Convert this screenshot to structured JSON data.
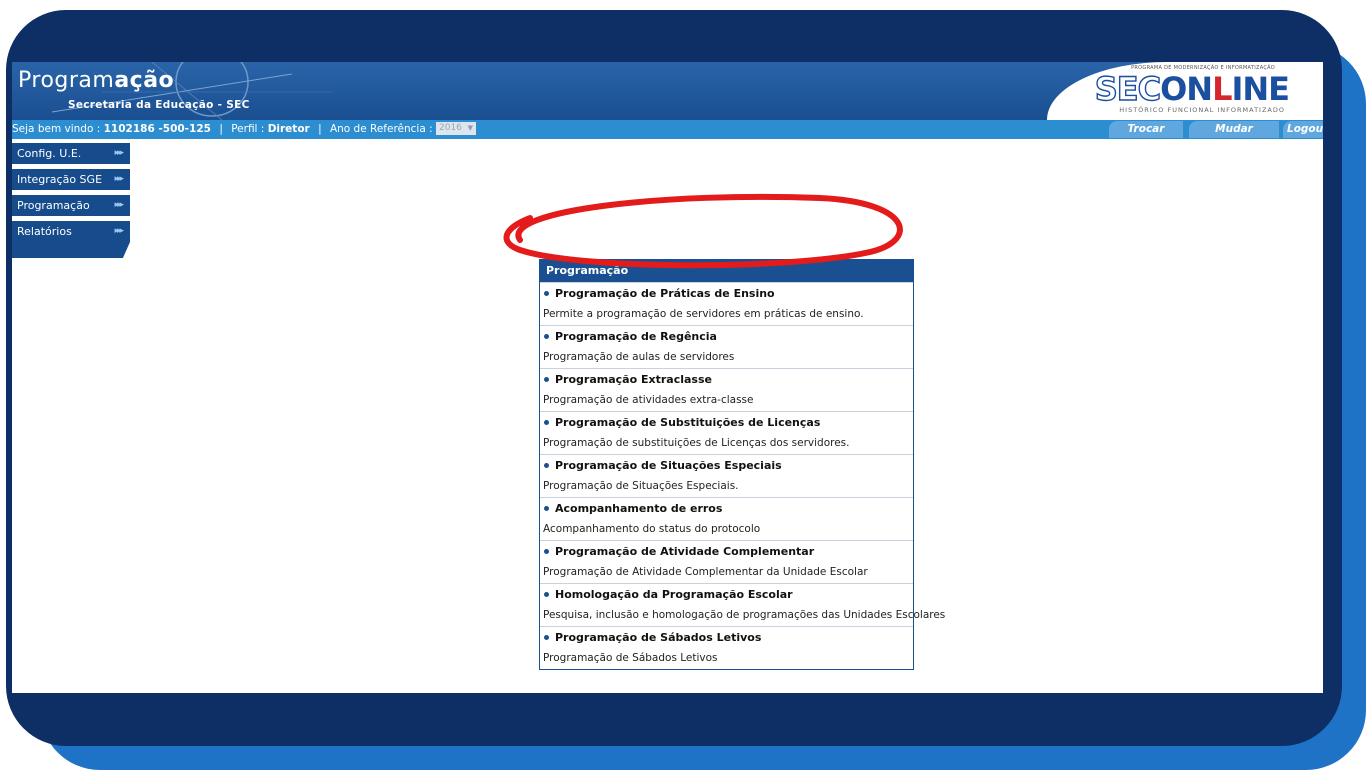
{
  "header": {
    "title_part1": "Program",
    "title_part2": "ação",
    "subtitle": "Secretaria da Educação - SEC",
    "logo": {
      "tagline": "PROGRAMA DE MODERNIZAÇÃO E INFORMATIZAÇÃO",
      "sec": "SEC",
      "online_on": "ON",
      "online_l": "L",
      "online_ine": "INE",
      "sub": "HISTÓRICO FUNCIONAL INFORMATIZADO"
    }
  },
  "topbar": {
    "welcome_label": "Seja bem vindo :",
    "welcome_value": "1102186 -500-125",
    "profile_label": "Perfil :",
    "profile_value": "Diretor",
    "year_label": "Ano de Referência :",
    "year_value": "2016",
    "actions": [
      "Trocar Senha",
      "Mudar Sistema",
      "Logout"
    ]
  },
  "sidebar": {
    "items": [
      {
        "label": "Config. U.E."
      },
      {
        "label": "Integração SGE"
      },
      {
        "label": "Programação"
      },
      {
        "label": "Relatórios"
      }
    ],
    "arrow_glyph": "▸▸▸"
  },
  "panel": {
    "title": "Programação",
    "entries": [
      {
        "title": "Programação de Práticas de Ensino",
        "desc": "Permite a programação de servidores em práticas de ensino."
      },
      {
        "title": "Programação de Regência",
        "desc": "Programação de aulas de servidores"
      },
      {
        "title": "Programação Extraclasse",
        "desc": "Programação de atividades extra-classe"
      },
      {
        "title": "Programação de Substituições de Licenças",
        "desc": "Programação de substituições de Licenças dos servidores."
      },
      {
        "title": "Programação de Situações Especiais",
        "desc": "Programação de Situações Especiais."
      },
      {
        "title": "Acompanhamento de erros",
        "desc": "Acompanhamento do status do protocolo"
      },
      {
        "title": "Programação de Atividade Complementar",
        "desc": "Programação de Atividade Complementar da Unidade Escolar"
      },
      {
        "title": "Homologação da Programação Escolar",
        "desc": "Pesquisa, inclusão e homologação de programações das Unidades Escolares"
      },
      {
        "title": "Programação de Sábados Letivos",
        "desc": "Programação de Sábados Letivos"
      }
    ]
  },
  "colors": {
    "frame_dark": "#0d2f66",
    "frame_light": "#1e73c6",
    "header_blue": "#1a4f91",
    "topbar_blue": "#2c8dd0",
    "highlight_red": "#e31b1b"
  }
}
